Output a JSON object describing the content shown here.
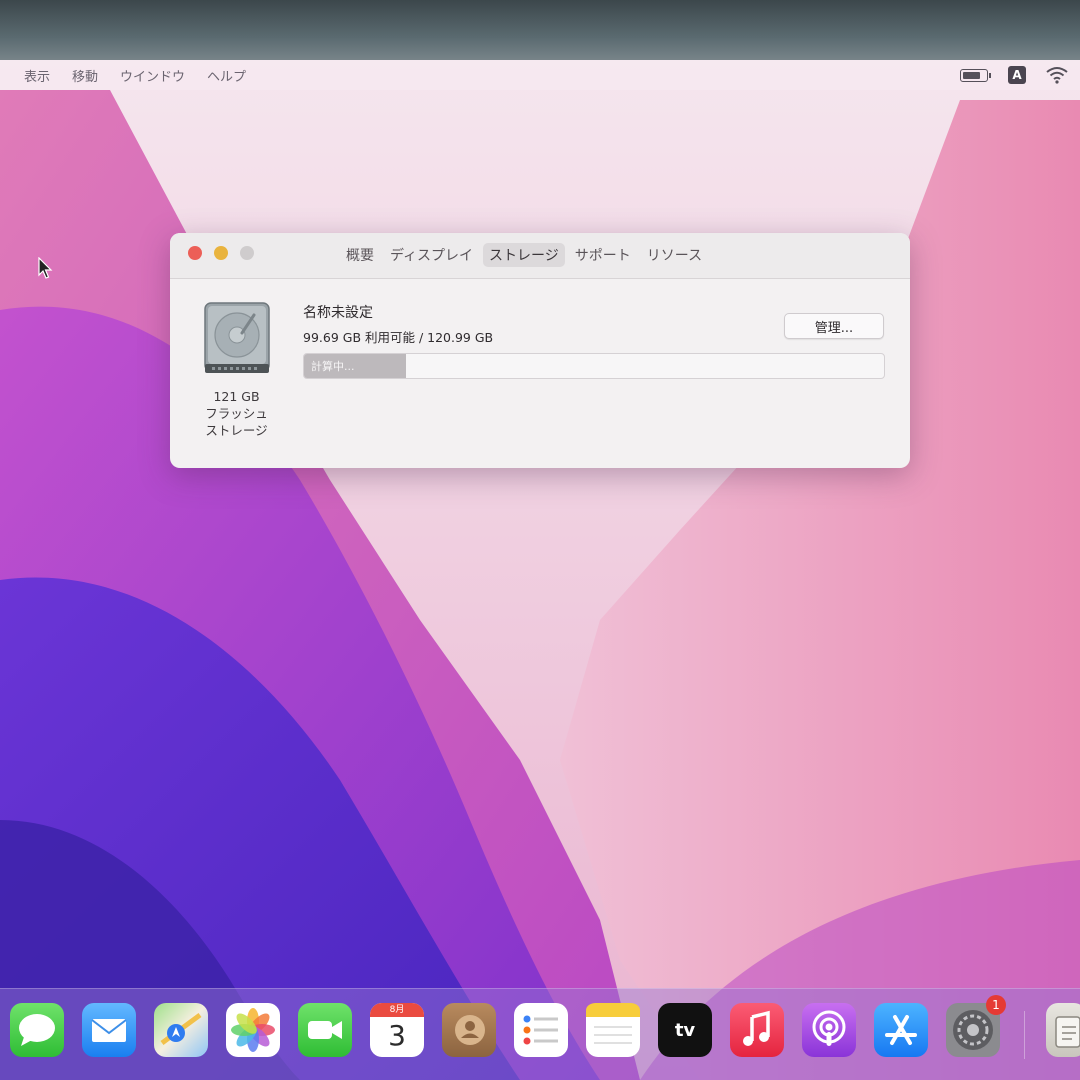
{
  "menubar": {
    "items": [
      "表示",
      "移動",
      "ウインドウ",
      "ヘルプ"
    ],
    "input_source": "A"
  },
  "window": {
    "tabs": [
      "概要",
      "ディスプレイ",
      "ストレージ",
      "サポート",
      "リソース"
    ],
    "active_tab": "ストレージ",
    "disk_caption": [
      "121 GB",
      "フラッシュ",
      "ストレージ"
    ],
    "volume_name": "名称未設定",
    "capacity_text": "99.69 GB 利用可能 / 120.99 GB",
    "manage_label": "管理...",
    "bar_label": "計算中...",
    "bar_fill_fraction": 0.175
  },
  "dock": {
    "calendar_month": "8月",
    "calendar_day": "3",
    "tv_label": "tv",
    "settings_badge": "1",
    "icons": [
      "messages-icon",
      "mail-icon",
      "maps-icon",
      "photos-icon",
      "facetime-icon",
      "calendar-icon",
      "contacts-icon",
      "reminders-icon",
      "notes-icon",
      "apple-tv-icon",
      "music-icon",
      "podcasts-icon",
      "app-store-icon",
      "system-preferences-icon",
      "utility-icon"
    ]
  },
  "colors": {
    "close": "#ec5f57",
    "minimize": "#e9b33e",
    "wallpaper_top": "#f2d7e4",
    "wallpaper_bottom": "#5b2fd1"
  }
}
